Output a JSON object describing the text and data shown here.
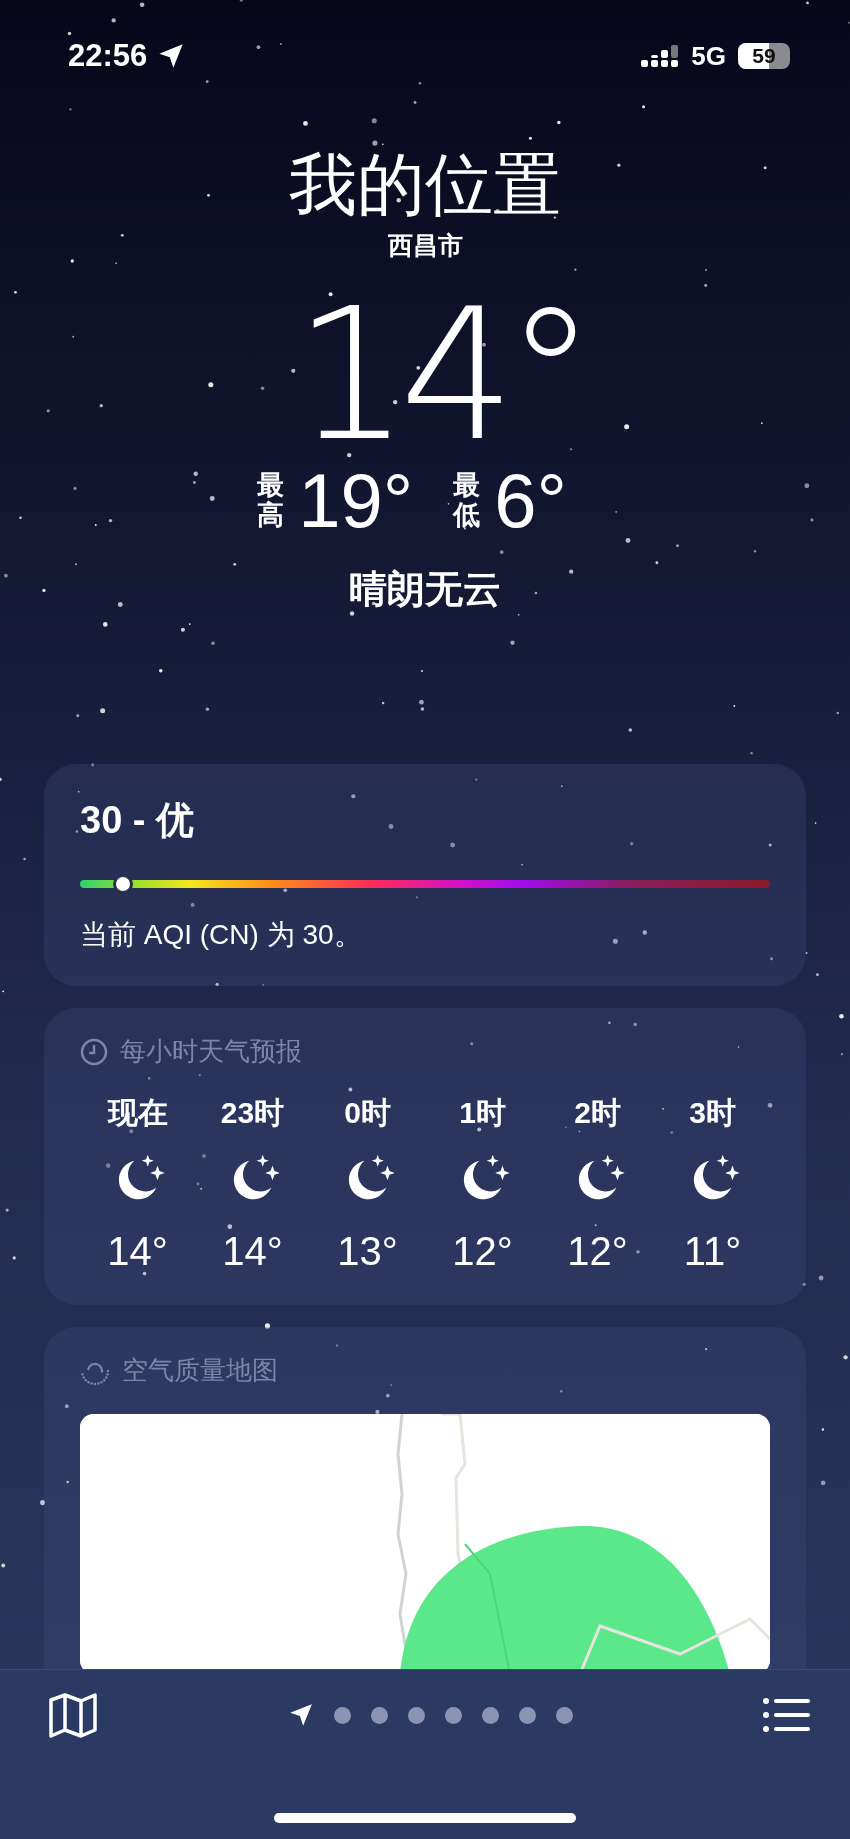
{
  "status_bar": {
    "time": "22:56",
    "network": "5G",
    "battery": "59"
  },
  "location": {
    "title": "我的位置",
    "city": "西昌市",
    "temperature": "14°",
    "high_label": "最高",
    "high": "19°",
    "low_label": "最低",
    "low": "6°",
    "condition": "晴朗无云"
  },
  "aqi": {
    "title": "30 - 优",
    "level": 0.063,
    "description": "当前 AQI (CN) 为 30。"
  },
  "hourly": {
    "title": "每小时天气预报",
    "hours": [
      {
        "label": "现在",
        "kind": "clear_night",
        "temp": "14°"
      },
      {
        "label": "23时",
        "kind": "clear_night",
        "temp": "14°"
      },
      {
        "label": "0时",
        "kind": "clear_night",
        "temp": "13°"
      },
      {
        "label": "1时",
        "kind": "clear_night",
        "temp": "12°"
      },
      {
        "label": "2时",
        "kind": "clear_night",
        "temp": "12°"
      },
      {
        "label": "3时",
        "kind": "clear_night",
        "temp": "11°"
      }
    ]
  },
  "air_map": {
    "title": "空气质量地图"
  },
  "pages": [
    {
      "kind": "location",
      "selected": true
    },
    {
      "kind": "dot",
      "selected": false
    },
    {
      "kind": "dot",
      "selected": false
    },
    {
      "kind": "dot",
      "selected": false
    },
    {
      "kind": "dot",
      "selected": false
    },
    {
      "kind": "dot",
      "selected": false
    },
    {
      "kind": "dot",
      "selected": false
    },
    {
      "kind": "dot",
      "selected": false
    }
  ]
}
